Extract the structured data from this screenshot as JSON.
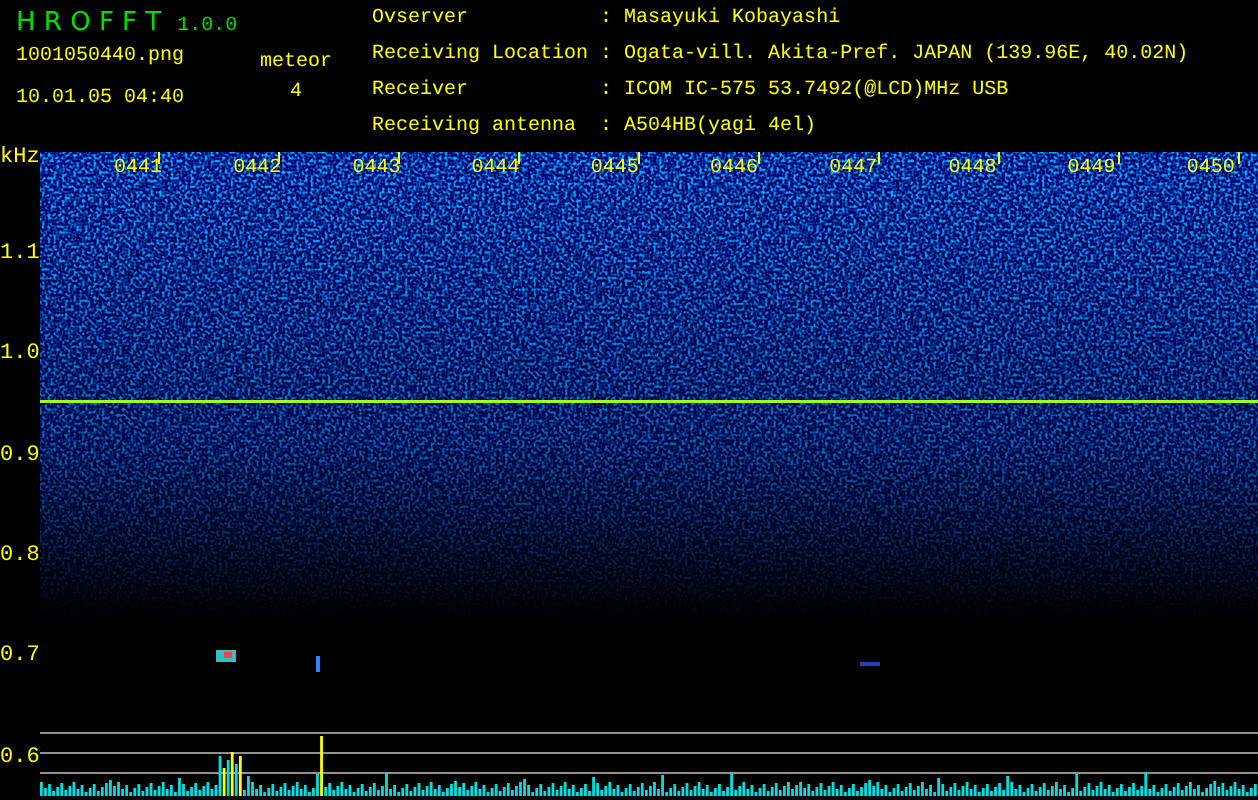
{
  "app": {
    "title": "H R O F F T",
    "version": "1.0.0"
  },
  "file": {
    "name": "1001050440.png",
    "datetime": "10.01.05 04:40"
  },
  "meteor": {
    "label": "meteor",
    "count": "4"
  },
  "info": [
    {
      "label": "Ovserver",
      "separator": ":",
      "value": "Masayuki Kobayashi"
    },
    {
      "label": "Receiving Location",
      "separator": ":",
      "value": "Ogata-vill. Akita-Pref. JAPAN (139.96E, 40.02N)"
    },
    {
      "label": "Receiver",
      "separator": ":",
      "value": "ICOM IC-575 53.7492(@LCD)MHz USB"
    },
    {
      "label": "Receiving antenna",
      "separator": ":",
      "value": "A504HB(yagi 4el)"
    }
  ],
  "plot": {
    "unit": "kHz",
    "y_labels": [
      "1.1",
      "1.0",
      "0.9",
      "0.8",
      "0.7",
      "0.6"
    ],
    "time_labels": [
      "0441",
      "0442",
      "0443",
      "0444",
      "0445",
      "0446",
      "0447",
      "0448",
      "0449",
      "0450"
    ]
  }
}
